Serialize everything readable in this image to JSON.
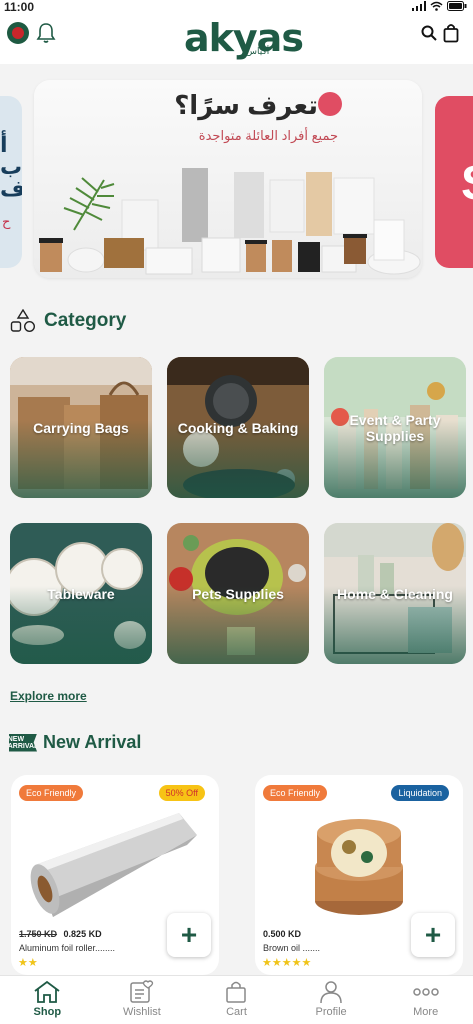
{
  "status_bar": {
    "time": "11:00"
  },
  "header": {
    "brand": "akyas",
    "brand_arabic": "أكياس"
  },
  "banner": {
    "title": "تعرف سرًا؟",
    "subtitle": "جميع أفراد العائلة متواجدة",
    "left_peek_text": "أ\nب\nف",
    "left_peek_sub": "ح",
    "right_peek_text": "S"
  },
  "category_section": {
    "title": "Category",
    "items": [
      {
        "label": "Carrying Bags"
      },
      {
        "label": "Cooking & Baking"
      },
      {
        "label": "Event & Party Supplies"
      },
      {
        "label": "Tableware"
      },
      {
        "label": "Pets Supplies"
      },
      {
        "label": "Home & Cleaning"
      }
    ],
    "explore_label": "Explore more"
  },
  "new_arrival": {
    "badge": "NEW ARRIVAL",
    "title": "New Arrival",
    "products": [
      {
        "tag_left": "Eco Friendly",
        "tag_right": "50% Off",
        "old_price": "1.750 KD",
        "price": "0.825 KD",
        "name": "Aluminum foil roller........",
        "stars": "★★",
        "add": "+"
      },
      {
        "tag_left": "Eco Friendly",
        "tag_right": "Liquidation",
        "old_price": "",
        "price": "0.500 KD",
        "name": "Brown oil .......",
        "stars": "★★★★★",
        "add": "+"
      }
    ]
  },
  "bottom_nav": [
    {
      "label": "Shop",
      "icon": "home-icon",
      "active": true
    },
    {
      "label": "Wishlist",
      "icon": "wishlist-icon",
      "active": false
    },
    {
      "label": "Cart",
      "icon": "cart-icon",
      "active": false
    },
    {
      "label": "Profile",
      "icon": "profile-icon",
      "active": false
    },
    {
      "label": "More",
      "icon": "more-icon",
      "active": false
    }
  ],
  "colors": {
    "brand_green": "#1f5a45",
    "eco_orange": "#f07a3b",
    "discount_yellow": "#f7c315",
    "liquidation_blue": "#1a62a0",
    "banner_pink": "#e04d63"
  }
}
